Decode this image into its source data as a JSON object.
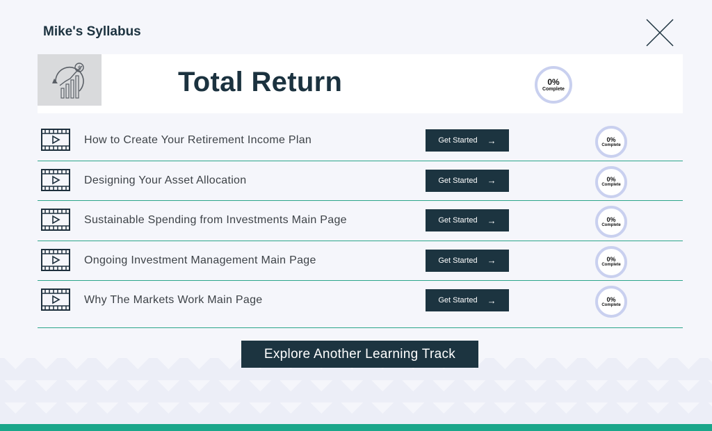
{
  "header": {
    "title": "Mike's Syllabus"
  },
  "course": {
    "title": "Total Return",
    "progress": {
      "percent": "0%",
      "label": "Complete"
    }
  },
  "lessons": [
    {
      "title": "How to Create Your Retirement Income Plan",
      "button_label": "Get Started",
      "progress": "0%",
      "progress_label": "Complete"
    },
    {
      "title": "Designing Your Asset Allocation",
      "button_label": "Get Started",
      "progress": "0%",
      "progress_label": "Complete"
    },
    {
      "title": "Sustainable Spending from Investments Main Page",
      "button_label": "Get Started",
      "progress": "0%",
      "progress_label": "Complete"
    },
    {
      "title": "Ongoing Investment Management Main Page",
      "button_label": "Get Started",
      "progress": "0%",
      "progress_label": "Complete"
    },
    {
      "title": "Why The Markets Work Main Page",
      "button_label": "Get Started",
      "progress": "0%",
      "progress_label": "Complete"
    }
  ],
  "footer": {
    "explore_label": "Explore Another Learning Track"
  },
  "icons": {
    "close": "close-icon",
    "video": "video-play-icon",
    "arrow": "arrow-right-icon",
    "course_image": "growth-chart-dollar-icon"
  },
  "colors": {
    "accent": "#1aa68a",
    "button_bg": "#1c3440",
    "ring": "#c9d0ef",
    "title": "#1b323f"
  }
}
